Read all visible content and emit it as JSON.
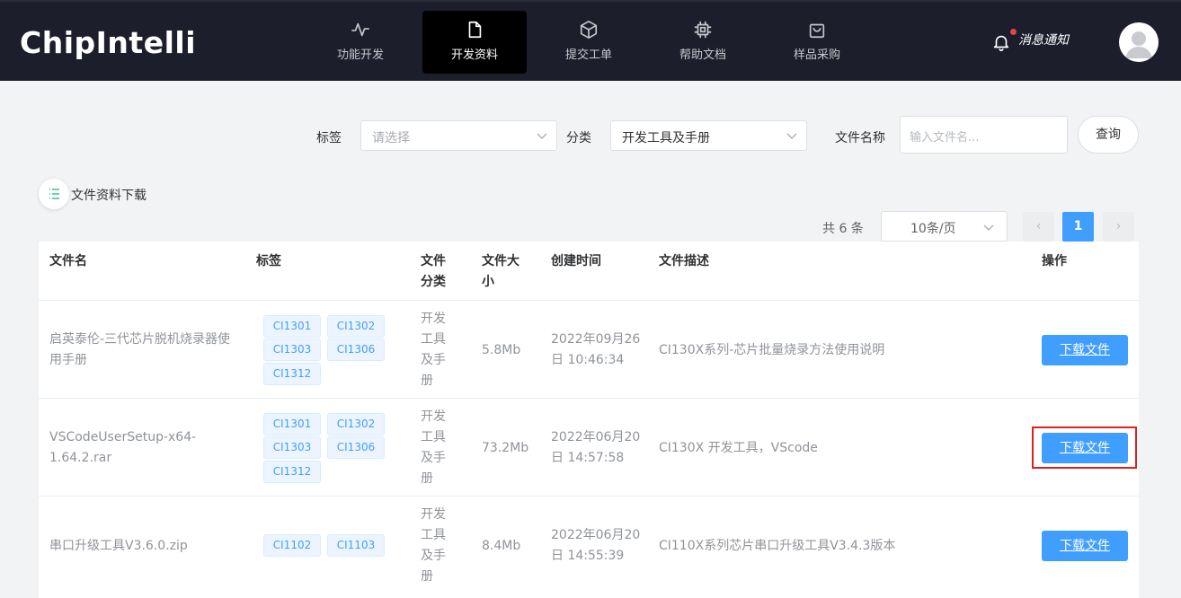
{
  "brand": {
    "logo": "ChipIntelli"
  },
  "nav": [
    {
      "label": "功能开发",
      "icon": "pulse-icon",
      "active": false
    },
    {
      "label": "开发资料",
      "icon": "document-icon",
      "active": true
    },
    {
      "label": "提交工单",
      "icon": "cube-icon",
      "active": false
    },
    {
      "label": "帮助文档",
      "icon": "chip-icon",
      "active": false
    },
    {
      "label": "样品采购",
      "icon": "shopping-bag-icon",
      "active": false
    }
  ],
  "header": {
    "notify": "消息通知"
  },
  "filters": {
    "tag_label": "标签",
    "tag_placeholder": "请选择",
    "category_label": "分类",
    "category_value": "开发工具及手册",
    "filename_label": "文件名称",
    "filename_placeholder": "输入文件名...",
    "query_button": "查询"
  },
  "section": {
    "title": "文件资料下载"
  },
  "pager": {
    "total": "共 6 条",
    "page_size": "10条/页",
    "prev": "‹",
    "current": "1",
    "next": "›"
  },
  "table": {
    "headers": {
      "name": "文件名",
      "tags": "标签",
      "category": "文件分类",
      "size": "文件大小",
      "created": "创建时间",
      "desc": "文件描述",
      "action": "操作"
    },
    "rows": [
      {
        "name": "启英泰伦-三代芯片脱机烧录器使用手册",
        "tags": [
          "CI1301",
          "CI1302",
          "CI1303",
          "CI1306",
          "CI1312"
        ],
        "category": "开发工具及手册",
        "size": "5.8Mb",
        "created": "2022年09月26日 10:46:34",
        "desc": "CI130X系列-芯片批量烧录方法使用说明",
        "action": "下载文件"
      },
      {
        "name": "VSCodeUserSetup-x64-1.64.2.rar",
        "tags": [
          "CI1301",
          "CI1302",
          "CI1303",
          "CI1306",
          "CI1312"
        ],
        "category": "开发工具及手册",
        "size": "73.2Mb",
        "created": "2022年06月20日 14:57:58",
        "desc": "CI130X 开发工具，VScode",
        "action": "下载文件"
      },
      {
        "name": "串口升级工具V3.6.0.zip",
        "tags": [
          "CI1102",
          "CI1103"
        ],
        "category": "开发工具及手册",
        "size": "8.4Mb",
        "created": "2022年06月20日 14:55:39",
        "desc": "CI110X系列芯片串口升级工具V3.4.3版本",
        "action": "下载文件"
      }
    ]
  },
  "colors": {
    "topbar": "#1d1e2c",
    "primary": "#409eff",
    "highlight": "#e02020"
  }
}
